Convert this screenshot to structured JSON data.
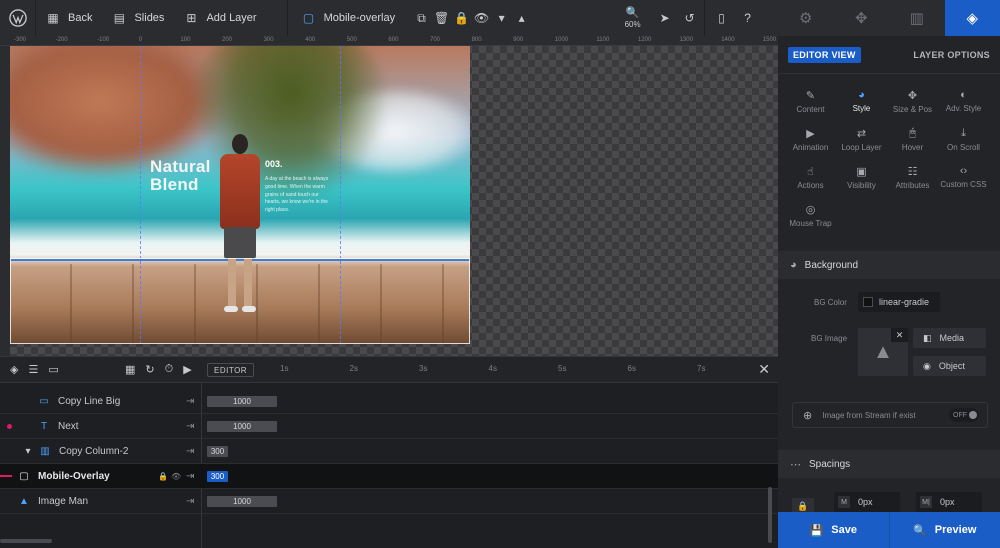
{
  "toolbar": {
    "back_label": "Back",
    "slides_label": "Slides",
    "add_layer_label": "Add Layer",
    "current_layer_label": "Mobile-overlay",
    "zoom_level": "60%"
  },
  "ruler": {
    "ticks": [
      "-300",
      "-200",
      "-100",
      "0",
      "100",
      "200",
      "300",
      "400",
      "500",
      "600",
      "700",
      "800",
      "900",
      "1000",
      "1100",
      "1200",
      "1300",
      "1400",
      "1500"
    ]
  },
  "slide": {
    "title_line1": "Natural",
    "title_line2": "Blend",
    "number": "003.",
    "copy": "A day at the beach is always good time. When the warm grains of sand touch our hearts, we know we're in the right place."
  },
  "timeline": {
    "editor_label": "EDITOR",
    "ticks": [
      "1s",
      "2s",
      "3s",
      "4s",
      "5s",
      "6s",
      "7s"
    ],
    "layers": [
      {
        "name": "Copy Line Big",
        "duration": "1000",
        "icon": "text-box-icon"
      },
      {
        "name": "Next",
        "duration": "1000",
        "icon": "text-icon"
      },
      {
        "name": "Copy Column-2",
        "duration": "300",
        "icon": "column-icon"
      },
      {
        "name": "Mobile-Overlay",
        "duration": "300",
        "icon": "shape-icon"
      },
      {
        "name": "Image Man",
        "duration": "1000",
        "icon": "image-icon"
      }
    ]
  },
  "panel": {
    "editor_view_label": "EDITOR VIEW",
    "layer_options_label": "LAYER OPTIONS",
    "tabs": [
      {
        "label": "Content",
        "icon": "pencil-icon"
      },
      {
        "label": "Style",
        "icon": "palette-icon"
      },
      {
        "label": "Size & Pos",
        "icon": "move-icon"
      },
      {
        "label": "Adv. Style",
        "icon": "contrast-icon"
      },
      {
        "label": "Animation",
        "icon": "play-icon"
      },
      {
        "label": "Loop Layer",
        "icon": "loop-icon"
      },
      {
        "label": "Hover",
        "icon": "mouse-icon"
      },
      {
        "label": "On Scroll",
        "icon": "scroll-icon"
      },
      {
        "label": "Actions",
        "icon": "hand-icon"
      },
      {
        "label": "Visibility",
        "icon": "visibility-icon"
      },
      {
        "label": "Attributes",
        "icon": "attributes-icon"
      },
      {
        "label": "Custom CSS",
        "icon": "code-icon"
      },
      {
        "label": "Mouse Trap",
        "icon": "target-icon"
      }
    ],
    "background_title": "Background",
    "bg_color_label": "BG Color",
    "bg_color_value": "linear-gradie",
    "bg_image_label": "BG Image",
    "media_label": "Media",
    "object_label": "Object",
    "stream_label": "Image from Stream if exist",
    "stream_toggle": "OFF",
    "spacings_title": "Spacings",
    "spacing_m1": "0px",
    "spacing_m2": "0px",
    "spacing_m1_icon_label": "M",
    "spacing_m2_icon_label": "M|"
  },
  "actions": {
    "save_label": "Save",
    "preview_label": "Preview"
  },
  "colors": {
    "accent": "#1a5dc6",
    "marker": "#e0196b"
  }
}
